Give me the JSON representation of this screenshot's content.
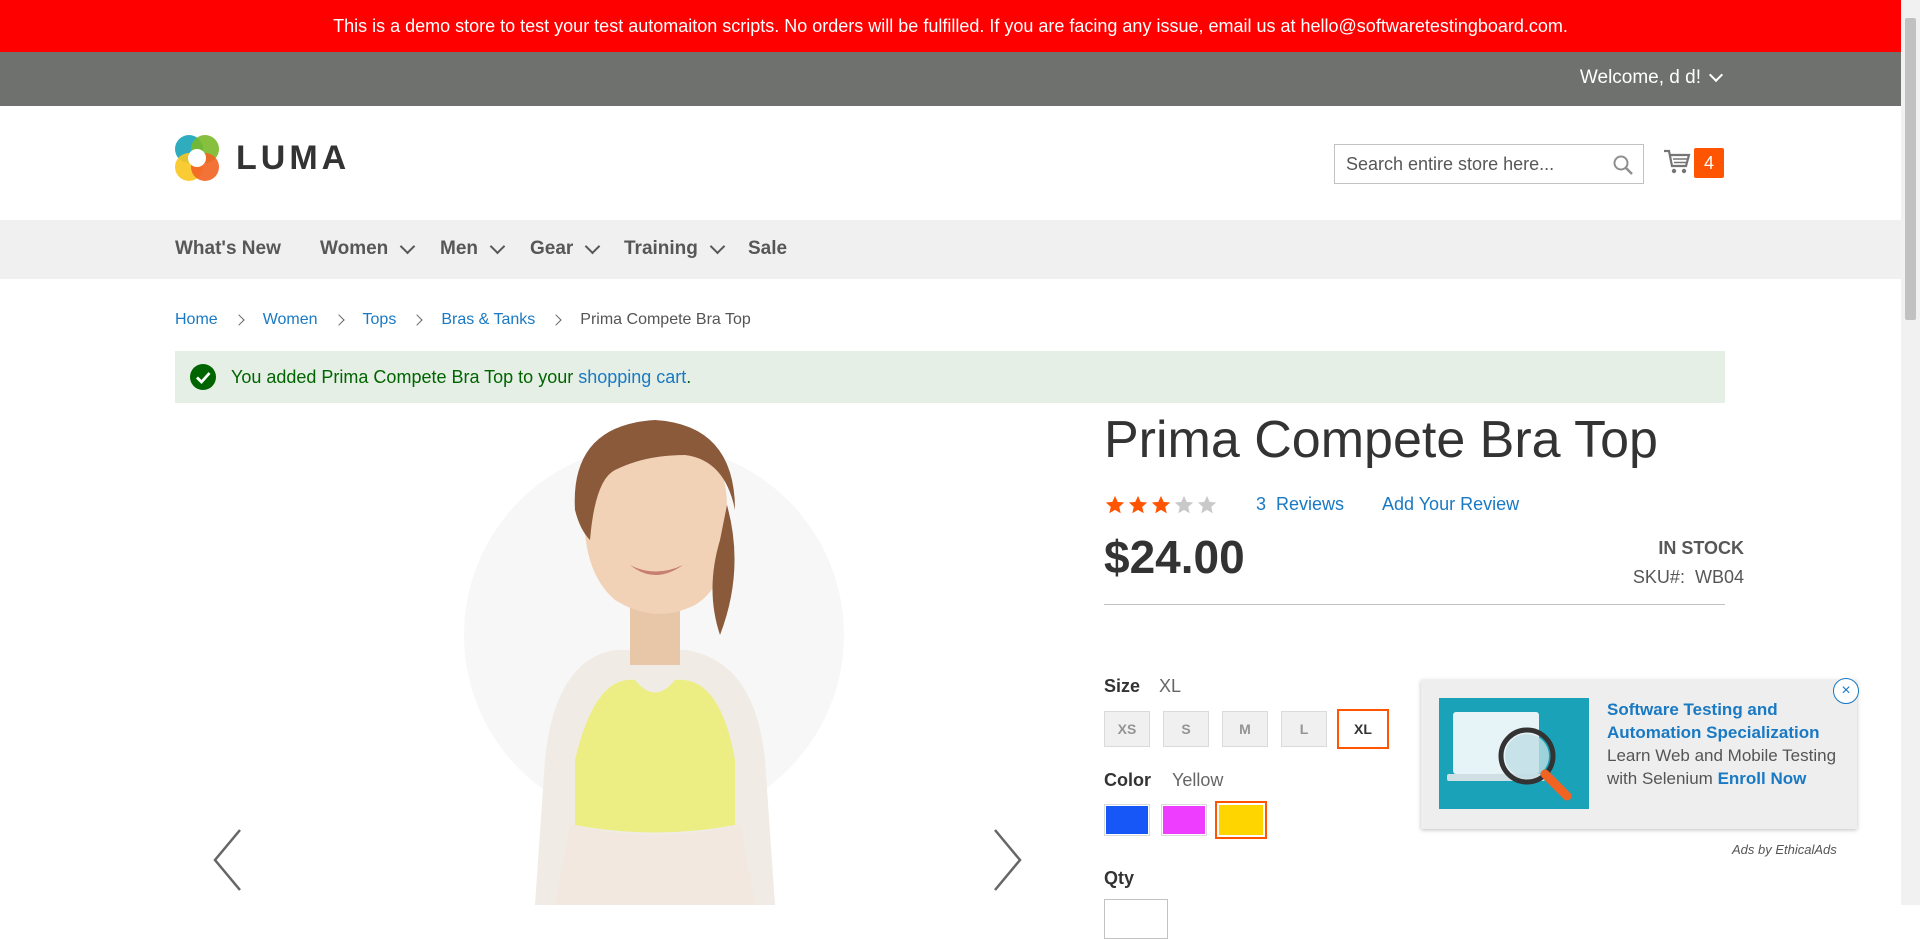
{
  "demo_banner": "This is a demo store to test your test automaiton scripts. No orders will be fulfilled. If you are facing any issue, email us at hello@softwaretestingboard.com.",
  "panel": {
    "welcome": "Welcome, d d!"
  },
  "header": {
    "logo_text": "LUMA",
    "search_placeholder": "Search entire store here...",
    "cart_count": "4"
  },
  "nav": {
    "items": [
      {
        "label": "What's New"
      },
      {
        "label": "Women"
      },
      {
        "label": "Men"
      },
      {
        "label": "Gear"
      },
      {
        "label": "Training"
      },
      {
        "label": "Sale"
      }
    ]
  },
  "breadcrumbs": [
    "Home",
    "Women",
    "Tops",
    "Bras & Tanks",
    "Prima Compete Bra Top"
  ],
  "message": {
    "prefix": "You added Prima Compete Bra Top to your ",
    "link": "shopping cart",
    "suffix": "."
  },
  "product": {
    "name": "Prima Compete Bra Top",
    "rating": 3,
    "rating_max": 5,
    "reviews_count": "3",
    "reviews_label": "Reviews",
    "add_review": "Add Your Review",
    "price": "$24.00",
    "stock": "IN STOCK",
    "sku_label": "SKU#:",
    "sku": "WB04",
    "size_label": "Size",
    "size_selected": "XL",
    "sizes": [
      "XS",
      "S",
      "M",
      "L",
      "XL"
    ],
    "color_label": "Color",
    "color_selected": "Yellow",
    "colors": [
      {
        "name": "Blue",
        "hex": "#1857f7"
      },
      {
        "name": "Purple",
        "hex": "#ef3dff"
      },
      {
        "name": "Yellow",
        "hex": "#ffd500"
      }
    ],
    "qty_label": "Qty"
  },
  "ad": {
    "title": "Software Testing and Automation Specialization",
    "body": "Learn Web and Mobile Testing with Selenium",
    "enroll": "Enroll Now",
    "by": "Ads by EthicalAds",
    "close": "×"
  },
  "colors": {
    "banner": "#ff0000",
    "panel": "#6e716e",
    "accent": "#ff5501",
    "link": "#1979c3",
    "success_bg": "#e5efe5",
    "success_text": "#006400"
  }
}
